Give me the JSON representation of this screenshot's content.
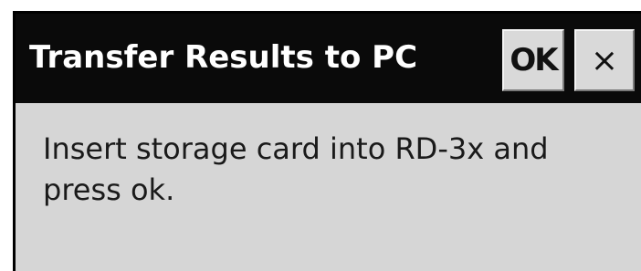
{
  "dialog": {
    "title": "Transfer Results to PC",
    "ok_label": "OK",
    "close_label": "×",
    "message": "Insert storage card into RD-3x and press ok."
  }
}
